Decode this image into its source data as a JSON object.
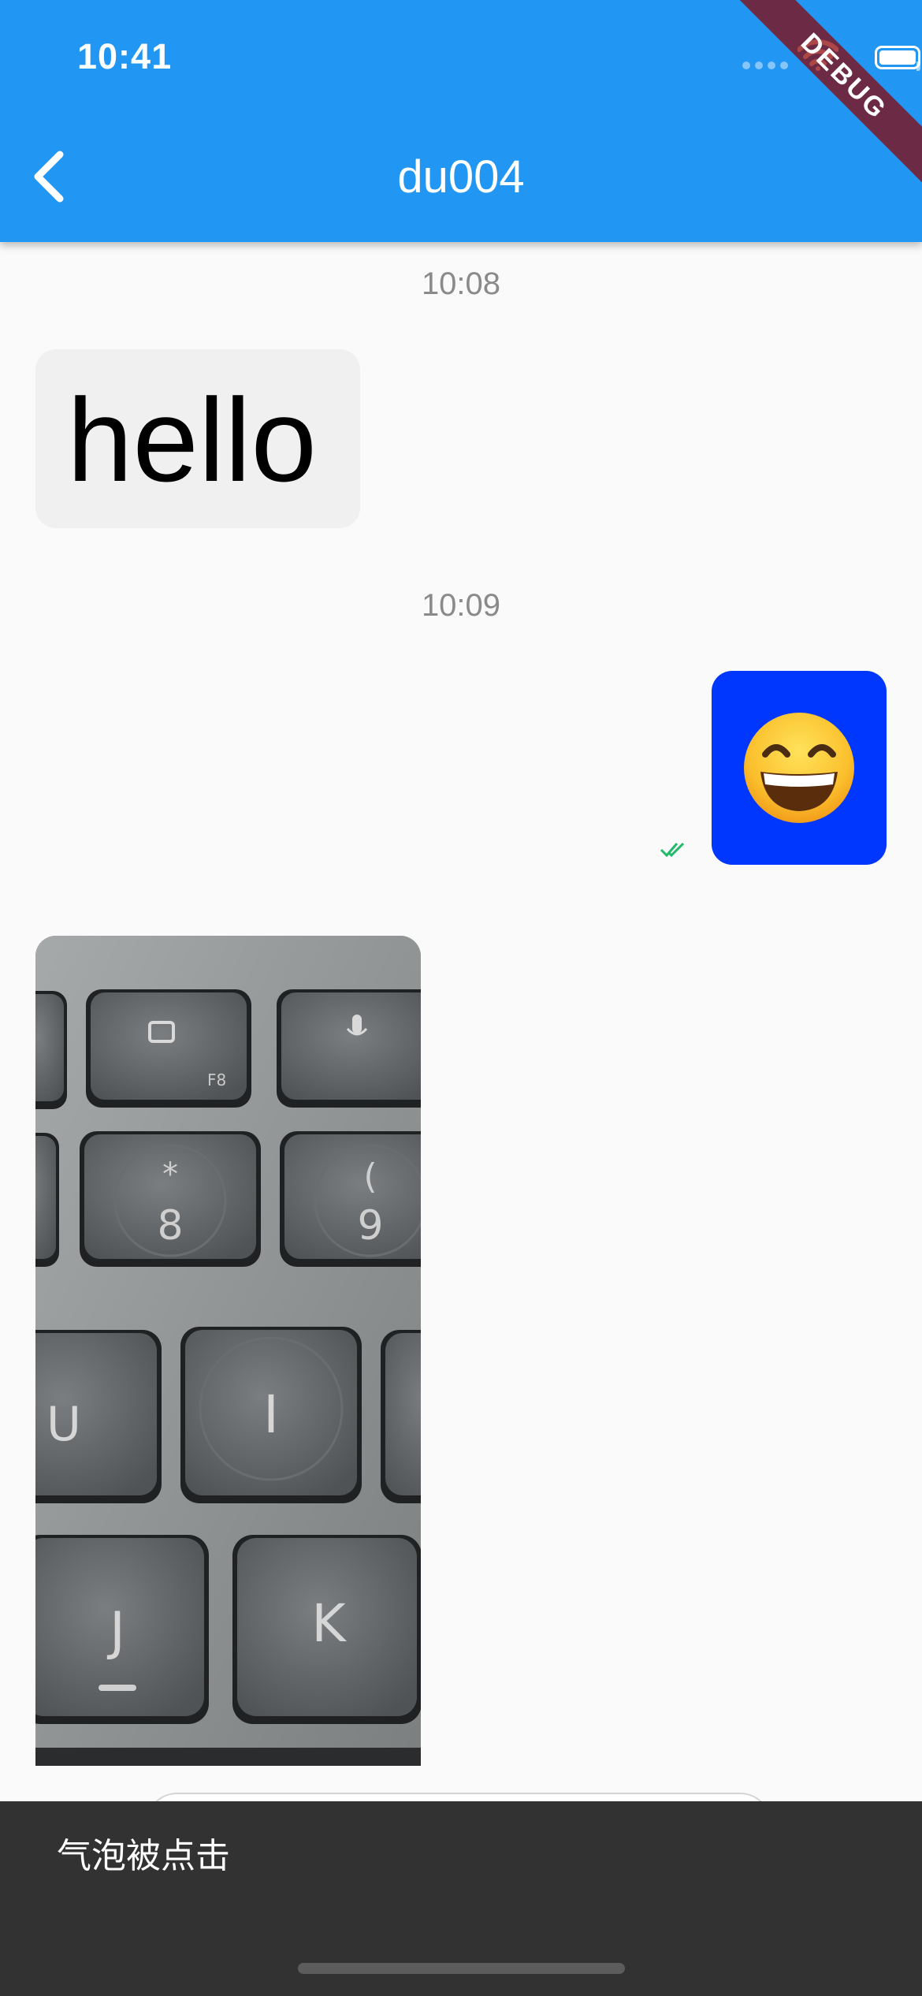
{
  "status_bar": {
    "time": "10:41"
  },
  "debug_banner": "DEBUG",
  "app_bar": {
    "title": "du004",
    "accent": "#2196f3"
  },
  "messages": [
    {
      "timestamp": "10:08",
      "direction": "incoming",
      "type": "text",
      "text": "hello"
    },
    {
      "timestamp": "10:09",
      "direction": "outgoing",
      "type": "emoji",
      "emoji": "grinning-face-with-smiling-eyes",
      "status": "read",
      "bubble_color": "#0037ff"
    },
    {
      "direction": "incoming",
      "type": "image",
      "image_subject": "keyboard-keys-photo"
    }
  ],
  "key_labels": {
    "f8": "F8",
    "star": "*",
    "eight": "8",
    "paren": "(",
    "nine": "9",
    "u": "U",
    "i": "I",
    "j": "J",
    "k": "K"
  },
  "snackbar": {
    "text": "气泡被点击",
    "background": "#323232"
  }
}
